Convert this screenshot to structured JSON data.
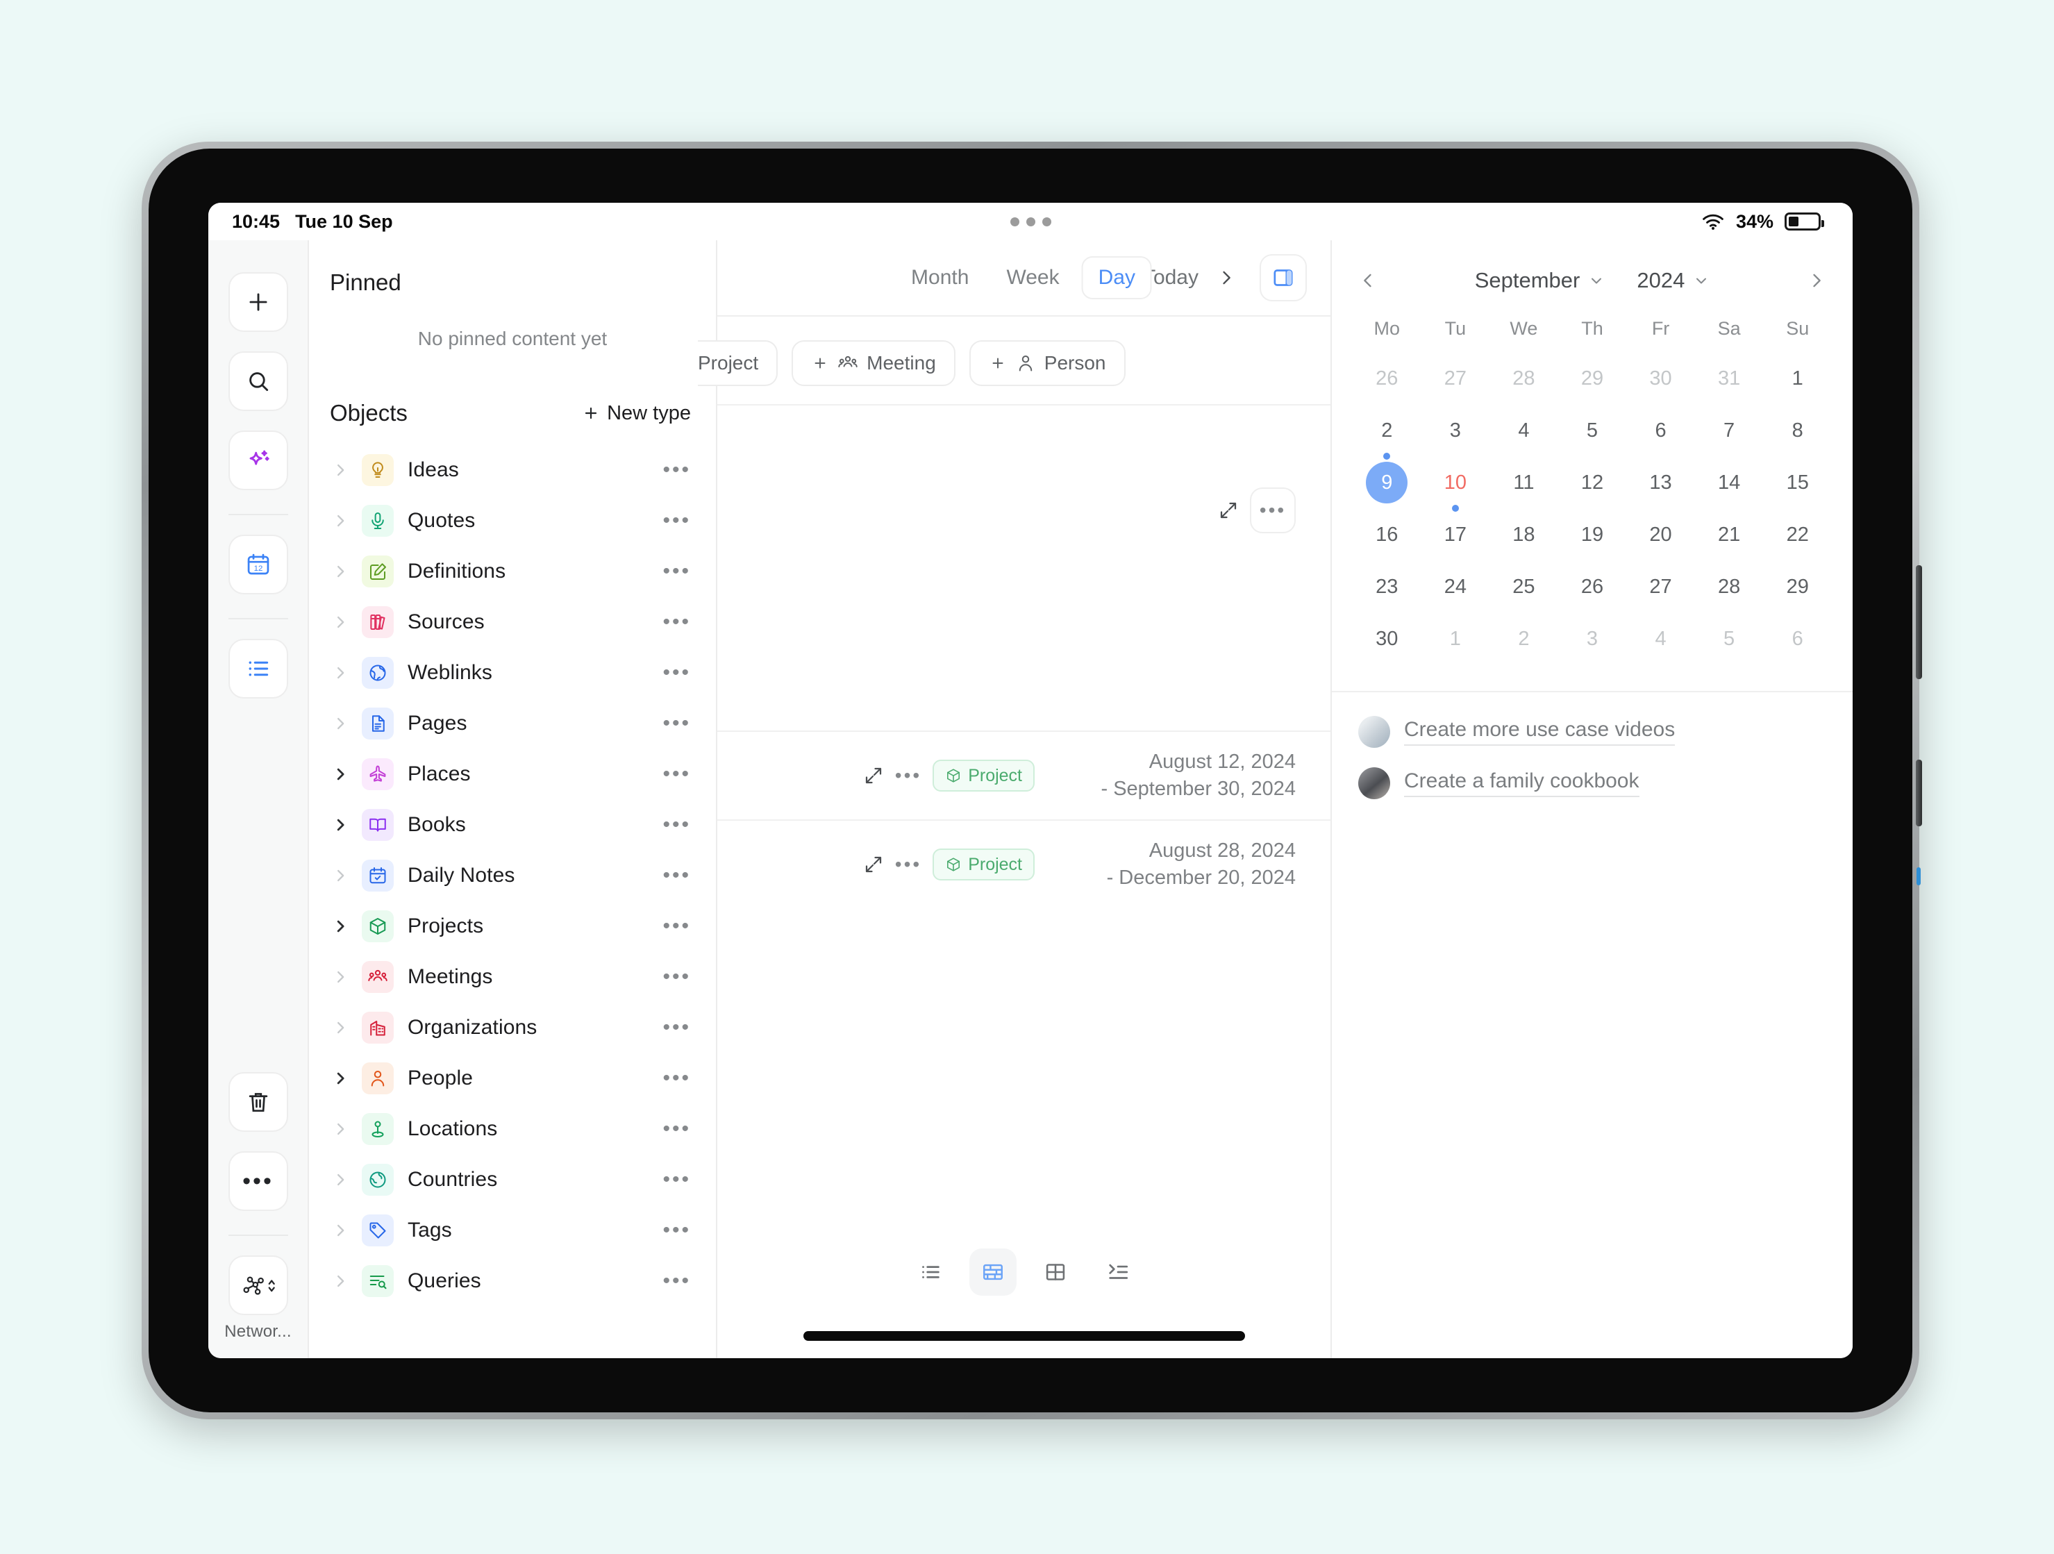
{
  "status_bar": {
    "time": "10:45",
    "date": "Tue 10 Sep",
    "battery_percent": "34%",
    "wifi_icon": "wifi-icon",
    "battery_icon": "battery-icon"
  },
  "icon_rail": {
    "items": [
      {
        "name": "create-object-button",
        "icon": "plus-icon"
      },
      {
        "name": "search-button",
        "icon": "search-icon"
      },
      {
        "name": "ai-assistant-button",
        "icon": "sparkle-icon"
      },
      {
        "name": "calendar-button",
        "icon": "calendar-12-icon"
      },
      {
        "name": "all-objects-button",
        "icon": "list-icon"
      },
      {
        "name": "bin-button",
        "icon": "trash-icon"
      },
      {
        "name": "more-button",
        "icon": "ellipsis-icon"
      }
    ],
    "space_label": "Networ...",
    "space_icon": "network-graph-icon"
  },
  "sidebar": {
    "pinned_title": "Pinned",
    "pinned_empty": "No pinned content yet",
    "objects_title": "Objects",
    "new_type_label": "New type",
    "new_type_icon": "plus-icon",
    "row_menu_icon": "ellipsis-icon",
    "items": [
      {
        "label": "Ideas",
        "icon": "lightbulb-icon",
        "glyph": "💡",
        "fg": "#c08b1b",
        "bg": "#fdf6e0",
        "expanded": false
      },
      {
        "label": "Quotes",
        "icon": "microphone-icon",
        "glyph": "🎤",
        "fg": "#12a474",
        "bg": "#e9fbf2",
        "expanded": false
      },
      {
        "label": "Definitions",
        "icon": "edit-note-icon",
        "glyph": "✎",
        "fg": "#5d9c22",
        "bg": "#f1fae1",
        "expanded": false
      },
      {
        "label": "Sources",
        "icon": "books-icon",
        "glyph": "📚",
        "fg": "#e03060",
        "bg": "#fdeaf0",
        "expanded": false
      },
      {
        "label": "Weblinks",
        "icon": "globe-icon",
        "glyph": "🌐",
        "fg": "#2767e8",
        "bg": "#e8efff",
        "expanded": false
      },
      {
        "label": "Pages",
        "icon": "document-icon",
        "glyph": "📄",
        "fg": "#2767e8",
        "bg": "#e8efff",
        "expanded": false
      },
      {
        "label": "Places",
        "icon": "airplane-icon",
        "glyph": "✈",
        "fg": "#c33fd6",
        "bg": "#fbeafd",
        "expanded": true
      },
      {
        "label": "Books",
        "icon": "open-book-icon",
        "glyph": "📖",
        "fg": "#8b2ff0",
        "bg": "#f2e9fe",
        "expanded": true
      },
      {
        "label": "Daily Notes",
        "icon": "calendar-check-icon",
        "glyph": "🗓",
        "fg": "#2767e8",
        "bg": "#e8efff",
        "expanded": false
      },
      {
        "label": "Projects",
        "icon": "package-icon",
        "glyph": "📦",
        "fg": "#189a54",
        "bg": "#eafaf0",
        "expanded": true
      },
      {
        "label": "Meetings",
        "icon": "people-group-icon",
        "glyph": "👥",
        "fg": "#d5203a",
        "bg": "#fdeaec",
        "expanded": false
      },
      {
        "label": "Organizations",
        "icon": "building-icon",
        "glyph": "🏢",
        "fg": "#d5203a",
        "bg": "#fdeaec",
        "expanded": false
      },
      {
        "label": "People",
        "icon": "person-icon",
        "glyph": "👤",
        "fg": "#e2561a",
        "bg": "#fdeee3",
        "expanded": true
      },
      {
        "label": "Locations",
        "icon": "map-pin-icon",
        "glyph": "📍",
        "fg": "#13a05b",
        "bg": "#eafaf0",
        "expanded": false
      },
      {
        "label": "Countries",
        "icon": "earth-icon",
        "glyph": "🌍",
        "fg": "#0f9a80",
        "bg": "#e9faf5",
        "expanded": false
      },
      {
        "label": "Tags",
        "icon": "tag-icon",
        "glyph": "🏷",
        "fg": "#2767e8",
        "bg": "#e8efff",
        "expanded": false
      },
      {
        "label": "Queries",
        "icon": "query-search-icon",
        "glyph": "🔎",
        "fg": "#179a4b",
        "bg": "#eafaf0",
        "expanded": false
      }
    ]
  },
  "content": {
    "view_tabs": [
      {
        "label": "Month",
        "active": false
      },
      {
        "label": "Week",
        "active": false
      },
      {
        "label": "Day",
        "active": true
      }
    ],
    "today_label": "Today",
    "prev_icon": "chevron-left-icon",
    "next_icon": "chevron-right-icon",
    "panel_toggle_icon": "side-panel-icon",
    "chips": [
      {
        "label": "Project",
        "icon": "package-icon",
        "clipped": true
      },
      {
        "label": "Meeting",
        "icon": "people-group-icon",
        "clipped": false
      },
      {
        "label": "Person",
        "icon": "person-icon",
        "clipped": false
      }
    ],
    "chip_add_icon": "plus-icon",
    "rows": [
      {
        "tag": "",
        "date_line1": "",
        "date_line2": "",
        "empty": true,
        "expand_icon": "expand-arrows-icon",
        "menu_icon": "ellipsis-icon"
      },
      {
        "tag": "Project",
        "tag_icon": "package-icon",
        "date_line1": "August 12, 2024",
        "date_line2": "- September 30, 2024",
        "empty": false,
        "expand_icon": "expand-arrows-icon",
        "menu_icon": "ellipsis-icon"
      },
      {
        "tag": "Project",
        "tag_icon": "package-icon",
        "date_line1": "August 28, 2024",
        "date_line2": "- December 20, 2024",
        "empty": false,
        "expand_icon": "expand-arrows-icon",
        "menu_icon": "ellipsis-icon"
      }
    ],
    "view_modes": [
      {
        "name": "list-view",
        "icon": "bullet-list-icon",
        "active": false
      },
      {
        "name": "grid-view",
        "icon": "brick-grid-icon",
        "active": true
      },
      {
        "name": "table-view",
        "icon": "table-icon",
        "active": false
      },
      {
        "name": "outline-view",
        "icon": "indent-list-icon",
        "active": false
      }
    ]
  },
  "calendar": {
    "month": "September",
    "year": "2024",
    "prev_icon": "chevron-left-icon",
    "next_icon": "chevron-right-icon",
    "month_caret_icon": "chevron-down-icon",
    "year_caret_icon": "chevron-down-icon",
    "dow": [
      "Mo",
      "Tu",
      "We",
      "Th",
      "Fr",
      "Sa",
      "Su"
    ],
    "weeks": [
      [
        {
          "n": "26",
          "state": "muted"
        },
        {
          "n": "27",
          "state": "muted"
        },
        {
          "n": "28",
          "state": "muted"
        },
        {
          "n": "29",
          "state": "muted"
        },
        {
          "n": "30",
          "state": "muted"
        },
        {
          "n": "31",
          "state": "muted"
        },
        {
          "n": "1",
          "state": "normal"
        }
      ],
      [
        {
          "n": "2",
          "state": "normal",
          "dot": true
        },
        {
          "n": "3",
          "state": "normal"
        },
        {
          "n": "4",
          "state": "normal"
        },
        {
          "n": "5",
          "state": "normal"
        },
        {
          "n": "6",
          "state": "normal"
        },
        {
          "n": "7",
          "state": "normal"
        },
        {
          "n": "8",
          "state": "normal"
        }
      ],
      [
        {
          "n": "9",
          "state": "selected"
        },
        {
          "n": "10",
          "state": "today",
          "dot": true
        },
        {
          "n": "11",
          "state": "normal"
        },
        {
          "n": "12",
          "state": "normal"
        },
        {
          "n": "13",
          "state": "normal"
        },
        {
          "n": "14",
          "state": "normal"
        },
        {
          "n": "15",
          "state": "normal"
        }
      ],
      [
        {
          "n": "16",
          "state": "normal"
        },
        {
          "n": "17",
          "state": "normal"
        },
        {
          "n": "18",
          "state": "normal"
        },
        {
          "n": "19",
          "state": "normal"
        },
        {
          "n": "20",
          "state": "normal"
        },
        {
          "n": "21",
          "state": "normal"
        },
        {
          "n": "22",
          "state": "normal"
        }
      ],
      [
        {
          "n": "23",
          "state": "normal"
        },
        {
          "n": "24",
          "state": "normal"
        },
        {
          "n": "25",
          "state": "normal"
        },
        {
          "n": "26",
          "state": "normal"
        },
        {
          "n": "27",
          "state": "normal"
        },
        {
          "n": "28",
          "state": "normal"
        },
        {
          "n": "29",
          "state": "normal"
        }
      ],
      [
        {
          "n": "30",
          "state": "normal"
        },
        {
          "n": "1",
          "state": "muted"
        },
        {
          "n": "2",
          "state": "muted"
        },
        {
          "n": "3",
          "state": "muted"
        },
        {
          "n": "4",
          "state": "muted"
        },
        {
          "n": "5",
          "state": "muted"
        },
        {
          "n": "6",
          "state": "muted"
        }
      ]
    ],
    "tasks": [
      {
        "label": "Create more use case videos",
        "avatar": "a1"
      },
      {
        "label": "Create a family cookbook",
        "avatar": "a2"
      }
    ]
  },
  "colors": {
    "page_background": "#ecf9f7",
    "accent_blue": "#4c8df6",
    "selected_day": "#7cabf7",
    "today_red": "#f16b63",
    "project_green": "#4bab6e"
  }
}
